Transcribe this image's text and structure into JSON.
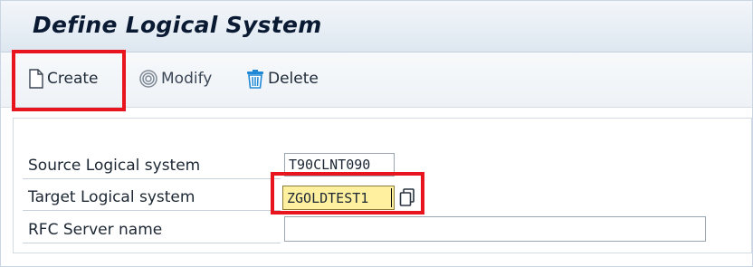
{
  "window": {
    "title": "Define Logical System"
  },
  "toolbar": {
    "create_label": "Create",
    "modify_label": "Modify",
    "delete_label": "Delete"
  },
  "form": {
    "source": {
      "label": "Source Logical system",
      "value": "T90CLNT090"
    },
    "target": {
      "label": "Target Logical system",
      "value": "ZGOLDTEST1"
    },
    "rfc": {
      "label": "RFC Server name",
      "value": ""
    }
  },
  "colors": {
    "highlight": "#e8151f",
    "required_field_bg": "#fff0a0",
    "title_text": "#0a1a33",
    "delete_icon": "#1e88d6"
  },
  "icons": {
    "create": "document-icon",
    "modify": "spiral-icon",
    "delete": "trash-icon",
    "f4_help": "value-help-icon"
  }
}
